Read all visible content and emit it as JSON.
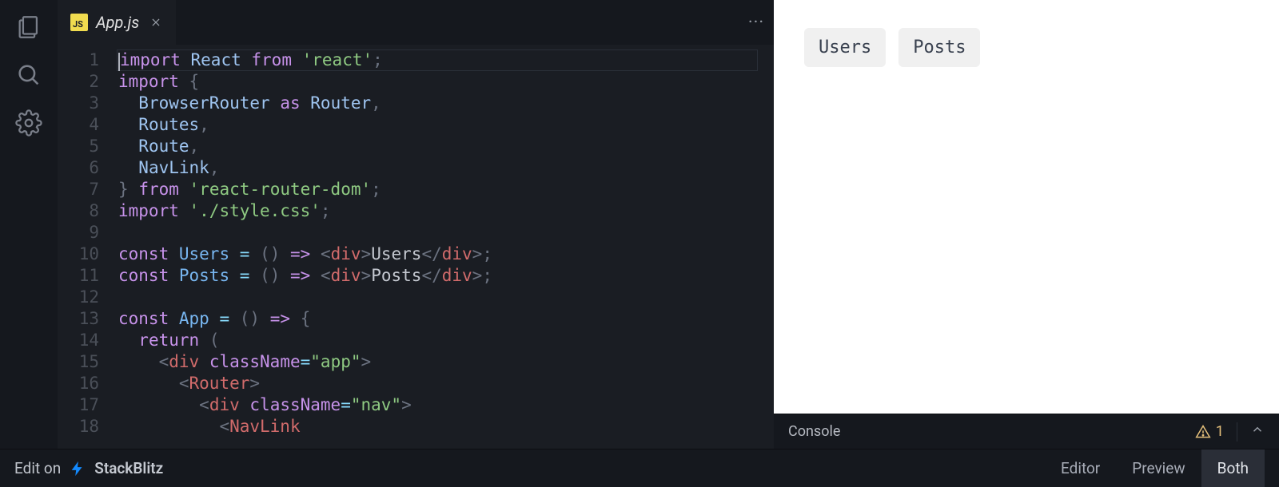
{
  "tab": {
    "filename": "App.js",
    "badge": "JS"
  },
  "gutter": [
    "1",
    "2",
    "3",
    "4",
    "5",
    "6",
    "7",
    "8",
    "9",
    "10",
    "11",
    "12",
    "13",
    "14",
    "15",
    "16",
    "17",
    "18"
  ],
  "code": {
    "l1": {
      "import": "import",
      "react": "React",
      "from": "from",
      "mod": "'react'",
      "semi": ";"
    },
    "l2": {
      "import": "import",
      "brace": "{"
    },
    "l3": {
      "name": "BrowserRouter",
      "as": "as",
      "alias": "Router",
      "comma": ","
    },
    "l4": {
      "name": "Routes",
      "comma": ","
    },
    "l5": {
      "name": "Route",
      "comma": ","
    },
    "l6": {
      "name": "NavLink",
      "comma": ","
    },
    "l7": {
      "brace": "}",
      "from": "from",
      "mod": "'react-router-dom'",
      "semi": ";"
    },
    "l8": {
      "import": "import",
      "mod": "'./style.css'",
      "semi": ";"
    },
    "l10": {
      "const": "const",
      "name": "Users",
      "eq": "=",
      "paren": "()",
      "arrow": "=>",
      "lt1": "<",
      "tag1": "div",
      "gt1": ">",
      "text": "Users",
      "lt2": "</",
      "tag2": "div",
      "gt2": ">",
      "semi": ";"
    },
    "l11": {
      "const": "const",
      "name": "Posts",
      "eq": "=",
      "paren": "()",
      "arrow": "=>",
      "lt1": "<",
      "tag1": "div",
      "gt1": ">",
      "text": "Posts",
      "lt2": "</",
      "tag2": "div",
      "gt2": ">",
      "semi": ";"
    },
    "l13": {
      "const": "const",
      "name": "App",
      "eq": "=",
      "paren": "()",
      "arrow": "=>",
      "brace": "{"
    },
    "l14": {
      "return": "return",
      "paren": "("
    },
    "l15": {
      "lt": "<",
      "tag": "div",
      "attr": "className",
      "eq": "=",
      "val": "\"app\"",
      "gt": ">"
    },
    "l16": {
      "lt": "<",
      "tag": "Router",
      "gt": ">"
    },
    "l17": {
      "lt": "<",
      "tag": "div",
      "attr": "className",
      "eq": "=",
      "val": "\"nav\"",
      "gt": ">"
    },
    "l18": {
      "lt": "<",
      "tag": "NavLink"
    }
  },
  "preview": {
    "nav": [
      "Users",
      "Posts"
    ]
  },
  "console": {
    "label": "Console",
    "warn_count": "1"
  },
  "footer": {
    "edit_on": "Edit on",
    "brand": "StackBlitz",
    "tabs": {
      "editor": "Editor",
      "preview": "Preview",
      "both": "Both"
    }
  }
}
